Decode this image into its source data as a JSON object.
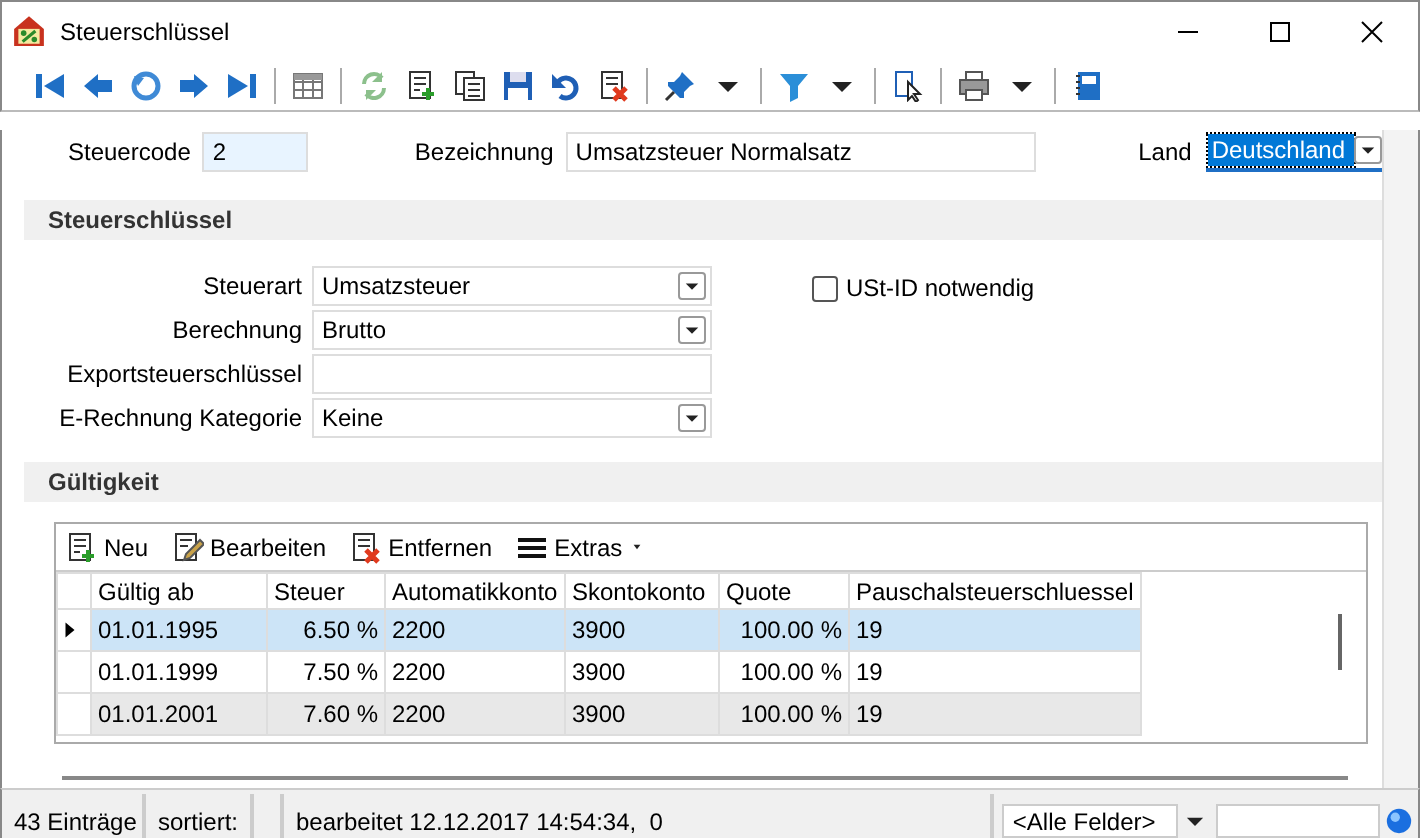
{
  "window": {
    "title": "Steuerschlüssel"
  },
  "header": {
    "steuercode": {
      "label": "Steuercode",
      "value": "2"
    },
    "bezeichnung": {
      "label": "Bezeichnung",
      "value": "Umsatzsteuer Normalsatz"
    },
    "land": {
      "label": "Land",
      "value": "Deutschland"
    }
  },
  "section_steuerschluessel": {
    "title": "Steuerschlüssel",
    "fields": [
      {
        "kind": "dropdown",
        "label": "Steuerart",
        "value": "Umsatzsteuer"
      },
      {
        "kind": "dropdown",
        "label": "Berechnung",
        "value": "Brutto"
      },
      {
        "kind": "text",
        "label": "Exportsteuerschlüssel"
      },
      {
        "kind": "dropdown",
        "label": "E-Rechnung Kategorie",
        "value": "Keine"
      }
    ],
    "checkbox": {
      "label": "USt-ID notwendig",
      "checked": false
    }
  },
  "section_gueltigkeit": {
    "title": "Gültigkeit",
    "toolbar": [
      {
        "kind": "new",
        "label": "Neu"
      },
      {
        "kind": "edit",
        "label": "Bearbeiten"
      },
      {
        "kind": "delete",
        "label": "Entfernen"
      },
      {
        "kind": "menu",
        "label": "Extras"
      }
    ],
    "table": {
      "columns": [
        {
          "label": "Gültig ab",
          "kind": "text"
        },
        {
          "label": "Steuer",
          "kind": "number"
        },
        {
          "label": "Automatikkonto",
          "kind": "text"
        },
        {
          "label": "Skontokonto",
          "kind": "text"
        },
        {
          "label": "Quote",
          "kind": "number"
        },
        {
          "label": "Pauschalsteuerschluessel",
          "kind": "text"
        }
      ],
      "rows": [
        {
          "selected": true,
          "cells": [
            "01.01.1995",
            "6.50 %",
            "2200",
            "3900",
            "100.00 %",
            "19"
          ]
        },
        {
          "selected": false,
          "cells": [
            "01.01.1999",
            "7.50 %",
            "2200",
            "3900",
            "100.00 %",
            "19"
          ]
        },
        {
          "selected": false,
          "cells": [
            "01.01.2001",
            "7.60 %",
            "2200",
            "3900",
            "100.00 %",
            "19"
          ]
        }
      ]
    }
  },
  "status_bar": {
    "count": "43 Einträge",
    "sort": "sortiert:",
    "edited": "bearbeitet 12.12.2017 14:54:34,  0",
    "search_scope": "<Alle Felder>"
  }
}
